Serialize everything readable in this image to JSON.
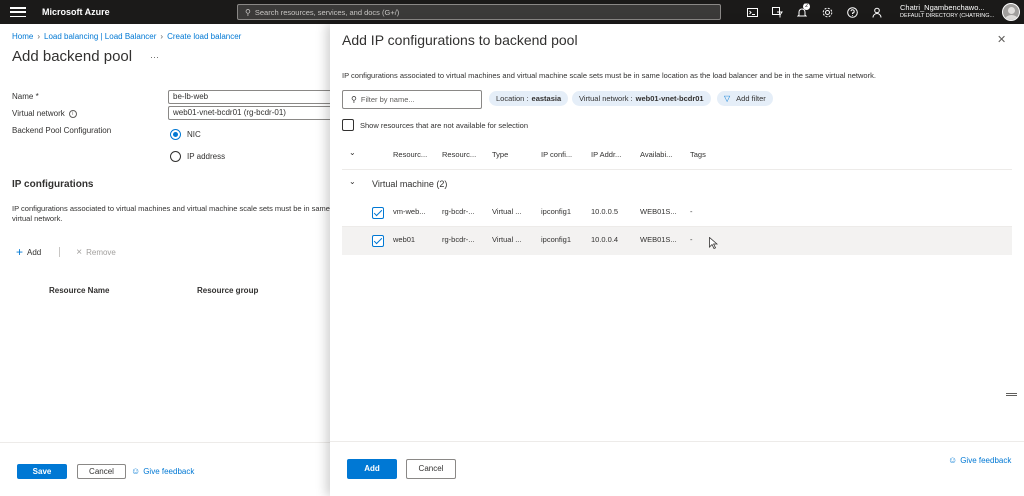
{
  "topbar": {
    "brand": "Microsoft Azure",
    "search_placeholder": "Search resources, services, and docs (G+/)",
    "notification_count": "2",
    "user_name": "Chatri_Ngambenchawo...",
    "user_directory": "DEFAULT DIRECTORY (CHATRING..."
  },
  "breadcrumb": [
    "Home",
    "Load balancing | Load Balancer",
    "Create load balancer"
  ],
  "left_blade": {
    "title": "Add backend pool",
    "ellipsis": "···",
    "name_label": "Name *",
    "name_value": "be-lb-web",
    "vnet_label": "Virtual network",
    "vnet_value": "web01-vnet-bcdr01 (rg-bcdr-01)",
    "pool_config_label": "Backend Pool Configuration",
    "radio_nic": "NIC",
    "radio_ip": "IP address",
    "section_title": "IP configurations",
    "section_desc": "IP configurations associated to virtual machines and virtual machine scale sets must be in same virtual network.",
    "add_label": "Add",
    "remove_label": "Remove",
    "col_resource_name": "Resource Name",
    "col_resource_group": "Resource group",
    "save_label": "Save",
    "cancel_label": "Cancel",
    "feedback_label": "Give feedback"
  },
  "panel": {
    "title": "Add IP configurations to backend pool",
    "description": "IP configurations associated to virtual machines and virtual machine scale sets must be in same location as the load balancer and be in the same virtual network.",
    "filter_placeholder": "Filter by name...",
    "pill_location_label": "Location :",
    "pill_location_value": "eastasia",
    "pill_vnet_label": "Virtual network :",
    "pill_vnet_value": "web01-vnet-bcdr01",
    "add_filter_label": "Add filter",
    "show_unavailable_label": "Show resources that are not available for selection",
    "columns": [
      "Resourc...",
      "Resourc...",
      "Type",
      "IP confi...",
      "IP Addr...",
      "Availabi...",
      "Tags"
    ],
    "group_label": "Virtual machine (2)",
    "rows": [
      {
        "checked": true,
        "cells": [
          "vm-web...",
          "rg-bcdr-...",
          "Virtual ...",
          "ipconfig1",
          "10.0.0.5",
          "WEB01S...",
          "-"
        ]
      },
      {
        "checked": true,
        "cells": [
          "web01",
          "rg-bcdr-...",
          "Virtual ...",
          "ipconfig1",
          "10.0.0.4",
          "WEB01S...",
          "-"
        ]
      }
    ],
    "add_label": "Add",
    "cancel_label": "Cancel",
    "feedback_label": "Give feedback"
  },
  "colors": {
    "accent": "#0078d4",
    "topbar_bg": "#1b1a19",
    "pill_bg": "#e5eef8"
  }
}
